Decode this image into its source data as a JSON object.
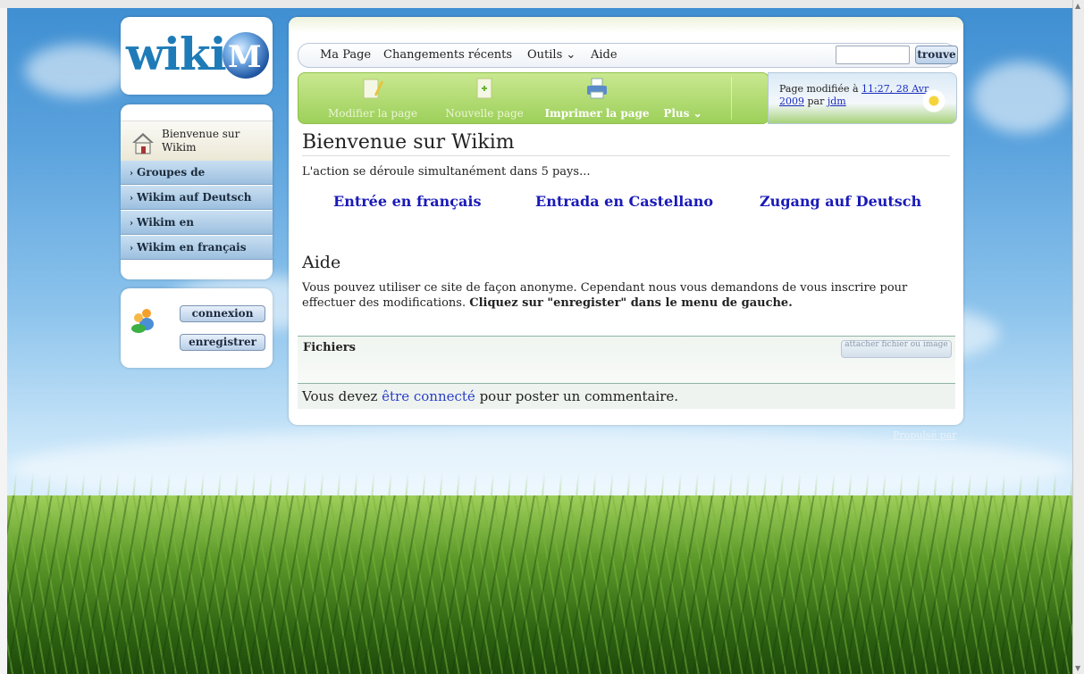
{
  "sidebar": {
    "logo": {
      "text_a": "wiki",
      "text_b": "M"
    },
    "home_label": "Bienvenue sur Wikim",
    "items": [
      {
        "label": "Groupes de"
      },
      {
        "label": "Wikim auf Deutsch"
      },
      {
        "label": "Wikim en"
      },
      {
        "label": "Wikim en français"
      }
    ],
    "login_button": "connexion",
    "register_button": "enregistrer"
  },
  "menubar": {
    "items": [
      "Ma Page",
      "Changements récents",
      "Outils",
      "Aide"
    ],
    "outils_arrow": "⌄",
    "search_button": "trouve"
  },
  "toolbar": {
    "edit_label": "Modifier la page",
    "new_label": "Nouvelle page",
    "print_label": "Imprimer la page",
    "more_label": "Plus ⌄"
  },
  "modified": {
    "prefix": "Page modifiée à",
    "time": "11:27, 28 Avr 2009",
    "by": "par",
    "user": "jdm"
  },
  "content": {
    "title": "Bienvenue sur Wikim",
    "intro": "L'action se déroule simultanément dans 5 pays...",
    "languages": [
      "Entrée en français",
      "Entrada en Castellano",
      "Zugang auf Deutsch"
    ],
    "help_title": "Aide",
    "help_text": "Vous pouvez utiliser ce site de façon anonyme. Cependant nous vous demandons de vous inscrire pour effectuer des modifications.",
    "help_bold": "Cliquez sur \"enregister\" dans le menu de gauche."
  },
  "files": {
    "label": "Fichiers",
    "attach_button": "attacher fichier ou image"
  },
  "comment": {
    "before": "Vous devez",
    "link": "être connecté",
    "after": "pour poster un commentaire."
  },
  "footer": {
    "powered": "Propulsé par"
  },
  "colors": {
    "link": "#1a1ab8",
    "toolbar_green": "#9dd05a",
    "nav_blue": "#9dc0e0"
  }
}
